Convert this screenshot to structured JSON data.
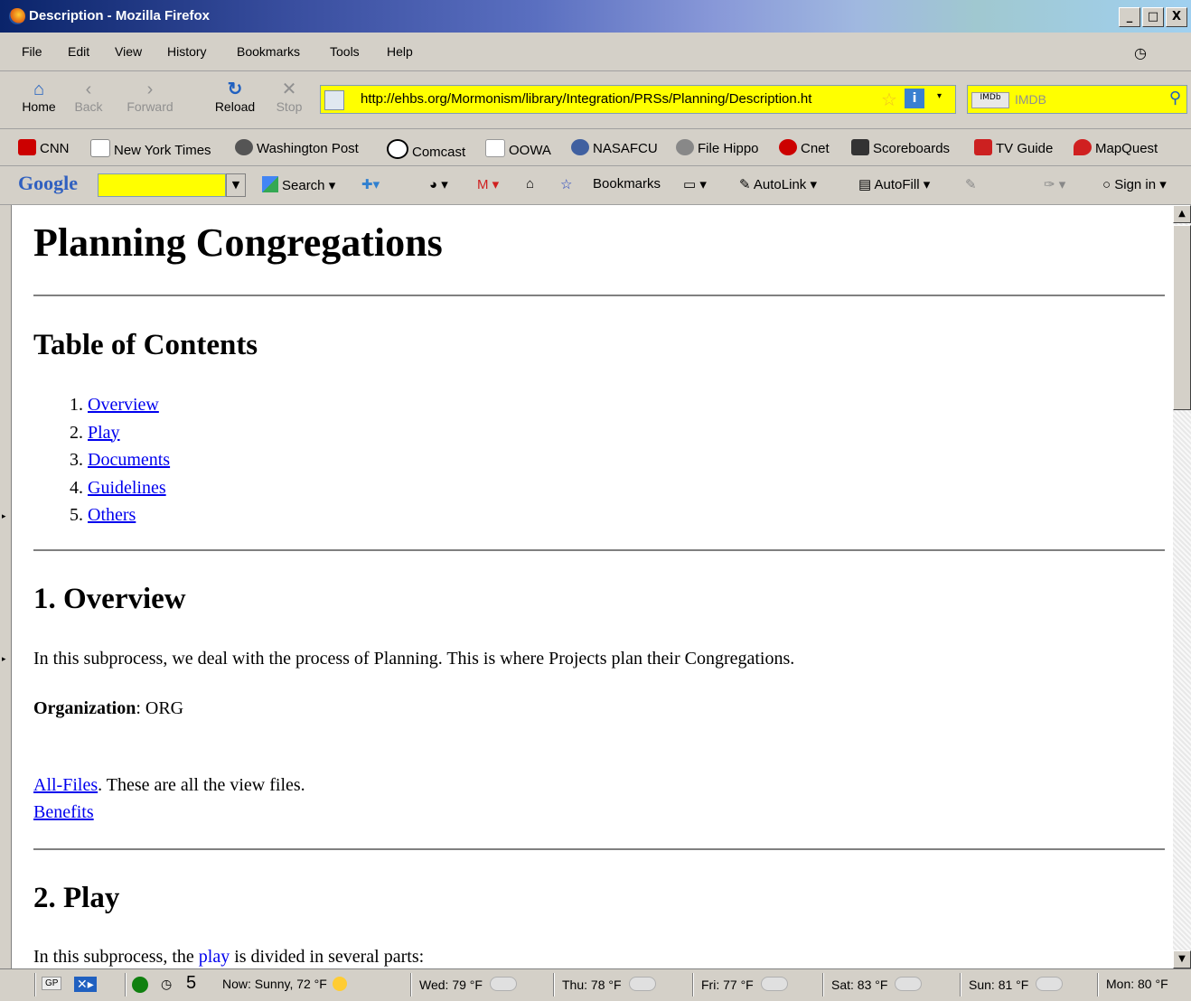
{
  "window": {
    "title": "Description - Mozilla Firefox",
    "controls": [
      "_",
      "□",
      "X"
    ]
  },
  "menu": [
    "File",
    "Edit",
    "View",
    "History",
    "Bookmarks",
    "Tools",
    "Help"
  ],
  "nav": {
    "home": "Home",
    "back": "Back",
    "forward": "Forward",
    "reload": "Reload",
    "stop": "Stop"
  },
  "url": "http://ehbs.org/Mormonism/library/Integration/PRSs/Planning/Description.ht",
  "search": {
    "placeholder": "IMDB"
  },
  "bookmarks": [
    "CNN",
    "New York Times",
    "Washington Post",
    "Comcast",
    "OOWA",
    "NASAFCU",
    "File Hippo",
    "Cnet",
    "Scoreboards",
    "TV Guide",
    "MapQuest"
  ],
  "google_toolbar": {
    "logo": "Google",
    "search": "Search",
    "bookmarks": "Bookmarks",
    "autolink": "AutoLink",
    "autofill": "AutoFill",
    "signin": "Sign in"
  },
  "page": {
    "title": "Planning Congregations",
    "toc_heading": "Table of Contents",
    "toc": [
      "Overview",
      "Play",
      "Documents",
      "Guidelines",
      "Others"
    ],
    "overview_heading": "1. Overview",
    "overview_text": "In this subprocess, we deal with the process of Planning. This is where Projects plan their Congregations.",
    "org_label": "Organization",
    "org_value": ": ORG",
    "allfiles_link": "All-Files",
    "allfiles_text": ". These are all the view files.",
    "benefits_link": "Benefits",
    "play_heading": "2. Play",
    "play_text_pre": "In this subprocess, the ",
    "play_link": "play",
    "play_text_post": " is divided in several parts:"
  },
  "status": {
    "gp": "GP",
    "count": "5",
    "now": "Now: Sunny, 72 °F",
    "wed": "Wed: 79 °F",
    "thu": "Thu: 78 °F",
    "fri": "Fri: 77 °F",
    "sat": "Sat: 83 °F",
    "sun": "Sun: 81 °F",
    "mon": "Mon: 80 °F"
  }
}
